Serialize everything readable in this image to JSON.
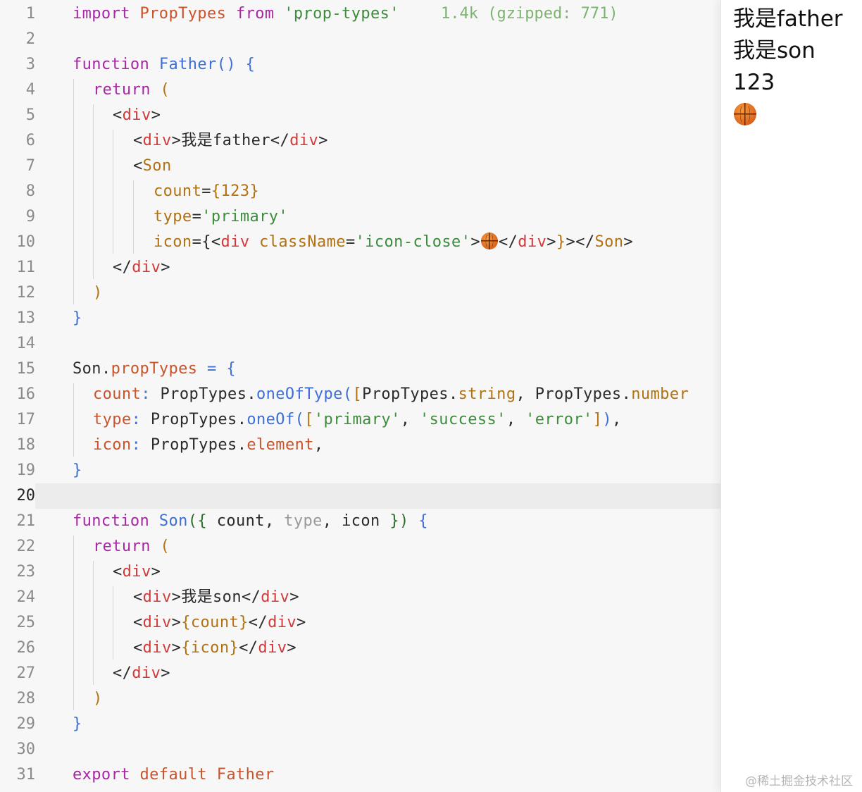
{
  "editor": {
    "line_numbers": [
      "1",
      "2",
      "3",
      "4",
      "5",
      "6",
      "7",
      "8",
      "9",
      "10",
      "11",
      "12",
      "13",
      "14",
      "15",
      "16",
      "17",
      "18",
      "19",
      "20",
      "21",
      "22",
      "23",
      "24",
      "25",
      "26",
      "27",
      "28",
      "29",
      "30",
      "31"
    ],
    "active_line": "20",
    "import_hint": "1.4k (gzipped: 771)",
    "lines": {
      "l1": [
        [
          "import",
          "k"
        ],
        [
          " PropTypes",
          "o"
        ],
        [
          " from ",
          "k"
        ],
        [
          "'prop-types'",
          "s"
        ]
      ],
      "l3": [
        [
          "function",
          "k"
        ],
        [
          " Father",
          "b"
        ],
        [
          "()",
          "b"
        ],
        [
          " {",
          "b"
        ]
      ],
      "l4": [
        [
          "return",
          "k"
        ],
        [
          " (",
          "br"
        ]
      ],
      "l5": [
        [
          "<",
          "p"
        ],
        [
          "div",
          "t"
        ],
        [
          ">",
          "p"
        ]
      ],
      "l6": [
        [
          "<",
          "p"
        ],
        [
          "div",
          "t"
        ],
        [
          ">我是father</",
          "p"
        ],
        [
          "div",
          "t"
        ],
        [
          ">",
          "p"
        ]
      ],
      "l7": [
        [
          "<",
          "p"
        ],
        [
          "Son",
          "br"
        ]
      ],
      "l8": [
        [
          "count",
          "br"
        ],
        [
          "=",
          "p"
        ],
        [
          "{123}",
          "br"
        ]
      ],
      "l9": [
        [
          "type",
          "br"
        ],
        [
          "=",
          "p"
        ],
        [
          "'primary'",
          "s"
        ]
      ],
      "l10": [
        [
          "icon",
          "br"
        ],
        [
          "={",
          "p"
        ],
        [
          "<",
          "p"
        ],
        [
          "div",
          "t"
        ],
        [
          " className",
          "br"
        ],
        [
          "=",
          "p"
        ],
        [
          "'icon-close'",
          "s"
        ],
        [
          ">",
          "p"
        ],
        [
          "EMOJI",
          "e"
        ],
        [
          "</",
          "p"
        ],
        [
          "div",
          "t"
        ],
        [
          ">",
          "p"
        ],
        [
          "}",
          "br"
        ],
        [
          "></",
          "p"
        ],
        [
          "Son",
          "br"
        ],
        [
          ">",
          "p"
        ]
      ],
      "l11": [
        [
          "</",
          "p"
        ],
        [
          "div",
          "t"
        ],
        [
          ">",
          "p"
        ]
      ],
      "l12": [
        [
          ")",
          "br"
        ]
      ],
      "l13": [
        [
          "}",
          "b"
        ]
      ],
      "l15": [
        [
          "Son",
          "p"
        ],
        [
          ".",
          "p"
        ],
        [
          "propTypes",
          "o"
        ],
        [
          " = ",
          "b"
        ],
        [
          "{",
          "b"
        ]
      ],
      "l16": [
        [
          "count",
          "o"
        ],
        [
          ": ",
          "b"
        ],
        [
          "PropTypes",
          "p"
        ],
        [
          ".",
          "p"
        ],
        [
          "oneOfType",
          "b"
        ],
        [
          "(",
          "b"
        ],
        [
          "[",
          "br"
        ],
        [
          "PropTypes",
          "p"
        ],
        [
          ".",
          "p"
        ],
        [
          "string",
          "br"
        ],
        [
          ", ",
          "p"
        ],
        [
          "PropTypes",
          "p"
        ],
        [
          ".",
          "p"
        ],
        [
          "number",
          "br"
        ]
      ],
      "l17": [
        [
          "type",
          "o"
        ],
        [
          ": ",
          "b"
        ],
        [
          "PropTypes",
          "p"
        ],
        [
          ".",
          "p"
        ],
        [
          "oneOf",
          "b"
        ],
        [
          "(",
          "b"
        ],
        [
          "[",
          "br"
        ],
        [
          "'primary'",
          "s"
        ],
        [
          ", ",
          "p"
        ],
        [
          "'success'",
          "s"
        ],
        [
          ", ",
          "p"
        ],
        [
          "'error'",
          "s"
        ],
        [
          "]",
          "br"
        ],
        [
          ")",
          "b"
        ],
        [
          ",",
          "p"
        ]
      ],
      "l18": [
        [
          "icon",
          "o"
        ],
        [
          ": ",
          "b"
        ],
        [
          "PropTypes",
          "p"
        ],
        [
          ".",
          "p"
        ],
        [
          "element",
          "o"
        ],
        [
          ",",
          "p"
        ]
      ],
      "l19": [
        [
          "}",
          "b"
        ]
      ],
      "l21": [
        [
          "function",
          "k"
        ],
        [
          " Son",
          "b"
        ],
        [
          "({",
          "g"
        ],
        [
          " count",
          "p"
        ],
        [
          ", ",
          "p"
        ],
        [
          "type",
          "m"
        ],
        [
          ", ",
          "p"
        ],
        [
          "icon",
          "p"
        ],
        [
          " })",
          "g"
        ],
        [
          " {",
          "b"
        ]
      ],
      "l22": [
        [
          "return",
          "k"
        ],
        [
          " (",
          "br"
        ]
      ],
      "l23": [
        [
          "<",
          "p"
        ],
        [
          "div",
          "t"
        ],
        [
          ">",
          "p"
        ]
      ],
      "l24": [
        [
          "<",
          "p"
        ],
        [
          "div",
          "t"
        ],
        [
          ">我是son</",
          "p"
        ],
        [
          "div",
          "t"
        ],
        [
          ">",
          "p"
        ]
      ],
      "l25": [
        [
          "<",
          "p"
        ],
        [
          "div",
          "t"
        ],
        [
          ">",
          "p"
        ],
        [
          "{count}",
          "br"
        ],
        [
          "</",
          "p"
        ],
        [
          "div",
          "t"
        ],
        [
          ">",
          "p"
        ]
      ],
      "l26": [
        [
          "<",
          "p"
        ],
        [
          "div",
          "t"
        ],
        [
          ">",
          "p"
        ],
        [
          "{icon}",
          "br"
        ],
        [
          "</",
          "p"
        ],
        [
          "div",
          "t"
        ],
        [
          ">",
          "p"
        ]
      ],
      "l27": [
        [
          "</",
          "p"
        ],
        [
          "div",
          "t"
        ],
        [
          ">",
          "p"
        ]
      ],
      "l28": [
        [
          ")",
          "br"
        ]
      ],
      "l29": [
        [
          "}",
          "b"
        ]
      ],
      "l31": [
        [
          "export",
          "k"
        ],
        [
          " default",
          "o"
        ],
        [
          " Father",
          "o"
        ]
      ]
    }
  },
  "preview": {
    "father_text": "我是father",
    "son_text": "我是son",
    "count_text": "123",
    "icon": "basketball-emoji"
  },
  "watermark": "@稀土掘金技术社区"
}
